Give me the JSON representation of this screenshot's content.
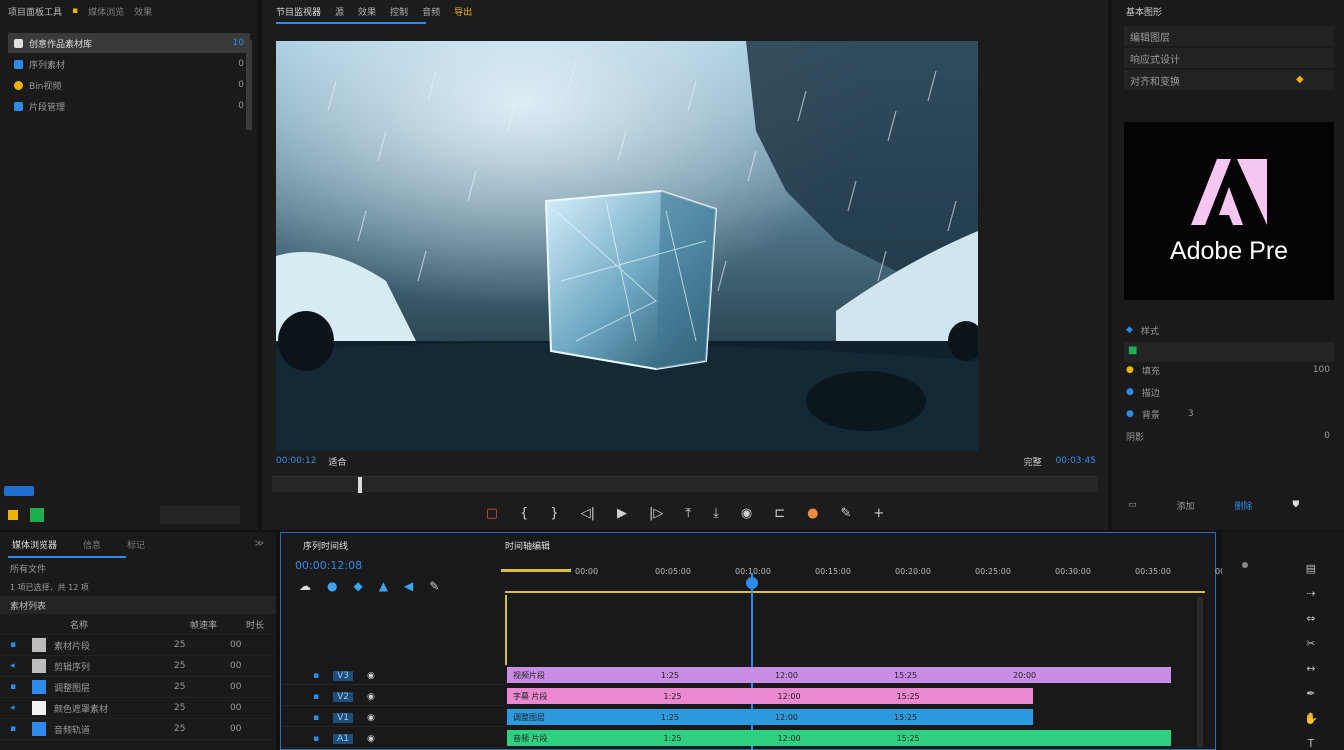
{
  "project_panel": {
    "title": "项目面板工具",
    "tabs": [
      "媒体浏览",
      "效果"
    ],
    "items": [
      {
        "label": "创意作品素材库",
        "count": "10",
        "color": "#e0e0e0"
      },
      {
        "label": "序列素材",
        "count": "0",
        "color": "#2d8ceb"
      },
      {
        "label": "Bin视频",
        "count": "0",
        "color": "#f0b400"
      },
      {
        "label": "片段管理",
        "count": "0",
        "color": "#2d8ceb"
      }
    ]
  },
  "monitor": {
    "tabs": [
      "节目监视器",
      "源",
      "效果",
      "控制",
      "音频",
      "导出"
    ],
    "timecode": "00:00:12",
    "fit_label": "适合",
    "quality": "完整",
    "duration": "00:03:45"
  },
  "right_panel": {
    "title": "基本图形",
    "rows": [
      "编辑图层",
      "响应式设计",
      "对齐和变换"
    ],
    "logo_text": "Adobe Pre",
    "props": [
      "样式",
      "填充",
      "描边",
      "背景",
      "阴影"
    ],
    "values": [
      "100",
      "3",
      "0"
    ],
    "footer": [
      "添加",
      "删除"
    ]
  },
  "browser": {
    "title": "媒体浏览器",
    "tabs": [
      "信息",
      "标记"
    ],
    "filter": "所有文件",
    "path": "1 项已选择，共 12 项",
    "section": "素材列表",
    "columns": [
      "名称",
      "帧速率",
      "时长"
    ],
    "rows": [
      {
        "name": "素材片段",
        "fps": "25",
        "dur": "00"
      },
      {
        "name": "剪辑序列",
        "fps": "25",
        "dur": "00"
      },
      {
        "name": "调整图层",
        "fps": "25",
        "dur": "00"
      },
      {
        "name": "颜色遮罩素材",
        "fps": "25",
        "dur": "00"
      },
      {
        "name": "音频轨道",
        "fps": "25",
        "dur": "00"
      }
    ]
  },
  "timeline": {
    "title": "序列时间线",
    "sequence_name": "时间轴编辑",
    "timecode": "00:00:12:08",
    "ruler": [
      "00:00",
      "00:05:00",
      "00:10:00",
      "00:15:00",
      "00:20:00",
      "00:25:00",
      "00:30:00",
      "00:35:00",
      "00:40:00"
    ],
    "tracks": [
      "V3",
      "V2",
      "V1",
      "A1"
    ],
    "clips": [
      {
        "label": "视频片段",
        "times": [
          "1:25",
          "12:00",
          "15:25",
          "20:00"
        ],
        "color": "#c98de6"
      },
      {
        "label": "字幕 片段",
        "times": [
          "1:25",
          "12:00",
          "15:25"
        ],
        "color": "#ea88d2"
      },
      {
        "label": "调整图层",
        "times": [
          "1:25",
          "12:00",
          "15:25"
        ],
        "color": "#2d9ae0"
      },
      {
        "label": "音频 片段",
        "times": [
          "1:25",
          "12:00",
          "15:25"
        ],
        "color": "#2fd07f"
      }
    ]
  }
}
